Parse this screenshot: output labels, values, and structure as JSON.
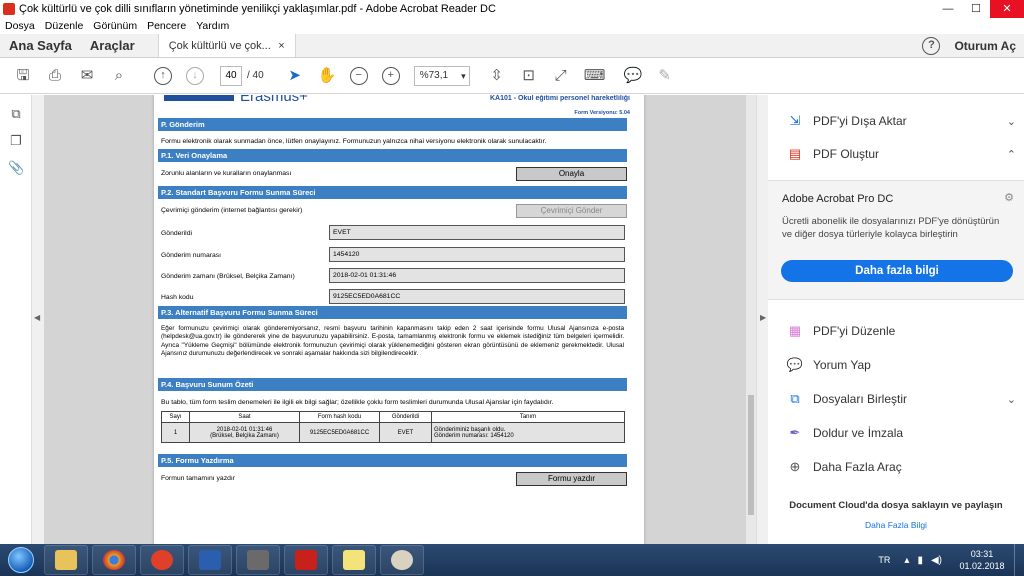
{
  "window": {
    "title": "Çok kültürlü ve çok dilli sınıfların yönetiminde yenilikçi yaklaşımlar.pdf - Adobe Acrobat Reader DC",
    "minimize": "—",
    "maximize": "☐",
    "close": "✕"
  },
  "menu": [
    "Dosya",
    "Düzenle",
    "Görünüm",
    "Pencere",
    "Yardım"
  ],
  "tabs": {
    "home": "Ana Sayfa",
    "tools": "Araçlar",
    "document": "Çok kültürlü ve çok...",
    "document_close": "×",
    "help": "?",
    "signin": "Oturum Aç"
  },
  "toolbar": {
    "page_current": "40",
    "page_total": "/ 40",
    "zoom": "%73,1"
  },
  "pdf": {
    "logo": "Erasmus+",
    "header_right": "KA101 - Okul eğitimi personel hareketliliği",
    "form_version": "Form Versiyonu: 5.04",
    "sec_p": "P. Gönderim",
    "p_intro": "Formu elektronik olarak sunmadan önce, lütfen onaylayınız. Formunuzun yalnızca nihai versiyonu elektronik olarak sunulacaktır.",
    "sec_p1": "P.1. Veri Onaylama",
    "p1_label": "Zorunlu alanların ve kuralların onaylanması",
    "p1_button": "Onayla",
    "sec_p2": "P.2. Standart Başvuru Formu Sunma Süreci",
    "p2_online_label": "Çevrimiçi gönderim (internet bağlantısı gerekir)",
    "p2_online_button": "Çevrimiçi Gönder",
    "p2_sent_label": "Gönderildi",
    "p2_sent_value": "EVET",
    "p2_num_label": "Gönderim numarası",
    "p2_num_value": "1454120",
    "p2_time_label": "Gönderim zamanı (Brüksel, Belçika Zamanı)",
    "p2_time_value": "2018-02-01 01:31:46",
    "p2_hash_label": "Hash kodu",
    "p2_hash_value": "9125EC5ED0A681CC",
    "sec_p3": "P.3. Alternatif Başvuru Formu Sunma Süreci",
    "p3_text": "Eğer formunuzu çevirimiçi olarak gönderemiyorsanız, resmi başvuru tarihinin kapanmasını takip eden 2 saat içerisinde formu Ulusal Ajansınıza e-posta (helpdesk@ua.gov.tr) ile göndererek yine de başvurunuzu yapabilirsiniz. E-posta, tamamlanmış elektronik formu ve eklemek istediğiniz tüm belgeleri içermelidir. Ayrıca \"Yükleme Geçmişi\" bölümünde elektronik formunuzun çevirimiçi olarak yüklenemediğini gösteren ekran görüntüsünü de eklemeniz gerekmektedir. Ulusal Ajansınız durumunuzu değerlendirecek ve sonraki aşamalar hakkında sizi bilgilendirecektir.",
    "sec_p4": "P.4. Başvuru Sunum Özeti",
    "p4_text": "Bu tablo, tüm form teslim denemeleri ile ilgili ek bilgi sağlar; özellikle çoklu form teslimleri durumunda Ulusal Ajanslar için faydalıdır.",
    "table": {
      "headers": [
        "Sayı",
        "Saat",
        "Form hash kodu",
        "Gönderildi",
        "Tanım"
      ],
      "row": {
        "num": "1",
        "time1": "2018-02-01 01:31:46",
        "time2": "(Brüksel, Belçika Zamanı)",
        "hash": "9125EC5ED0A681CC",
        "sent": "EVET",
        "desc1": "Gönderiminiz başarılı oldu.",
        "desc2": "Gönderim numarası: 1454120"
      }
    },
    "sec_p5": "P.5. Formu Yazdırma",
    "p5_label": "Formun tamamını yazdır",
    "p5_button": "Formu yazdır"
  },
  "right_panel": {
    "export": "PDF'yi Dışa Aktar",
    "create": "PDF Oluştur",
    "promo_title": "Adobe Acrobat Pro DC",
    "promo_desc": "Ücretli abonelik ile dosyalarınızı PDF'ye dönüştürün ve diğer dosya türleriyle kolayca birleştirin",
    "promo_button": "Daha fazla bilgi",
    "edit": "PDF'yi Düzenle",
    "comment": "Yorum Yap",
    "combine": "Dosyaları Birleştir",
    "fill_sign": "Doldur ve İmzala",
    "more_tools": "Daha Fazla Araç",
    "cloud": "Document Cloud'da dosya saklayın ve paylaşın",
    "cloud_more": "Daha Fazla Bilgi"
  },
  "taskbar": {
    "lang": "TR",
    "time": "03:31",
    "date": "01.02.2018"
  },
  "colors": {
    "section_blue": "#3c7fc2",
    "acrobat_blue": "#1473e6",
    "erasmus_blue": "#1f4f9e"
  }
}
